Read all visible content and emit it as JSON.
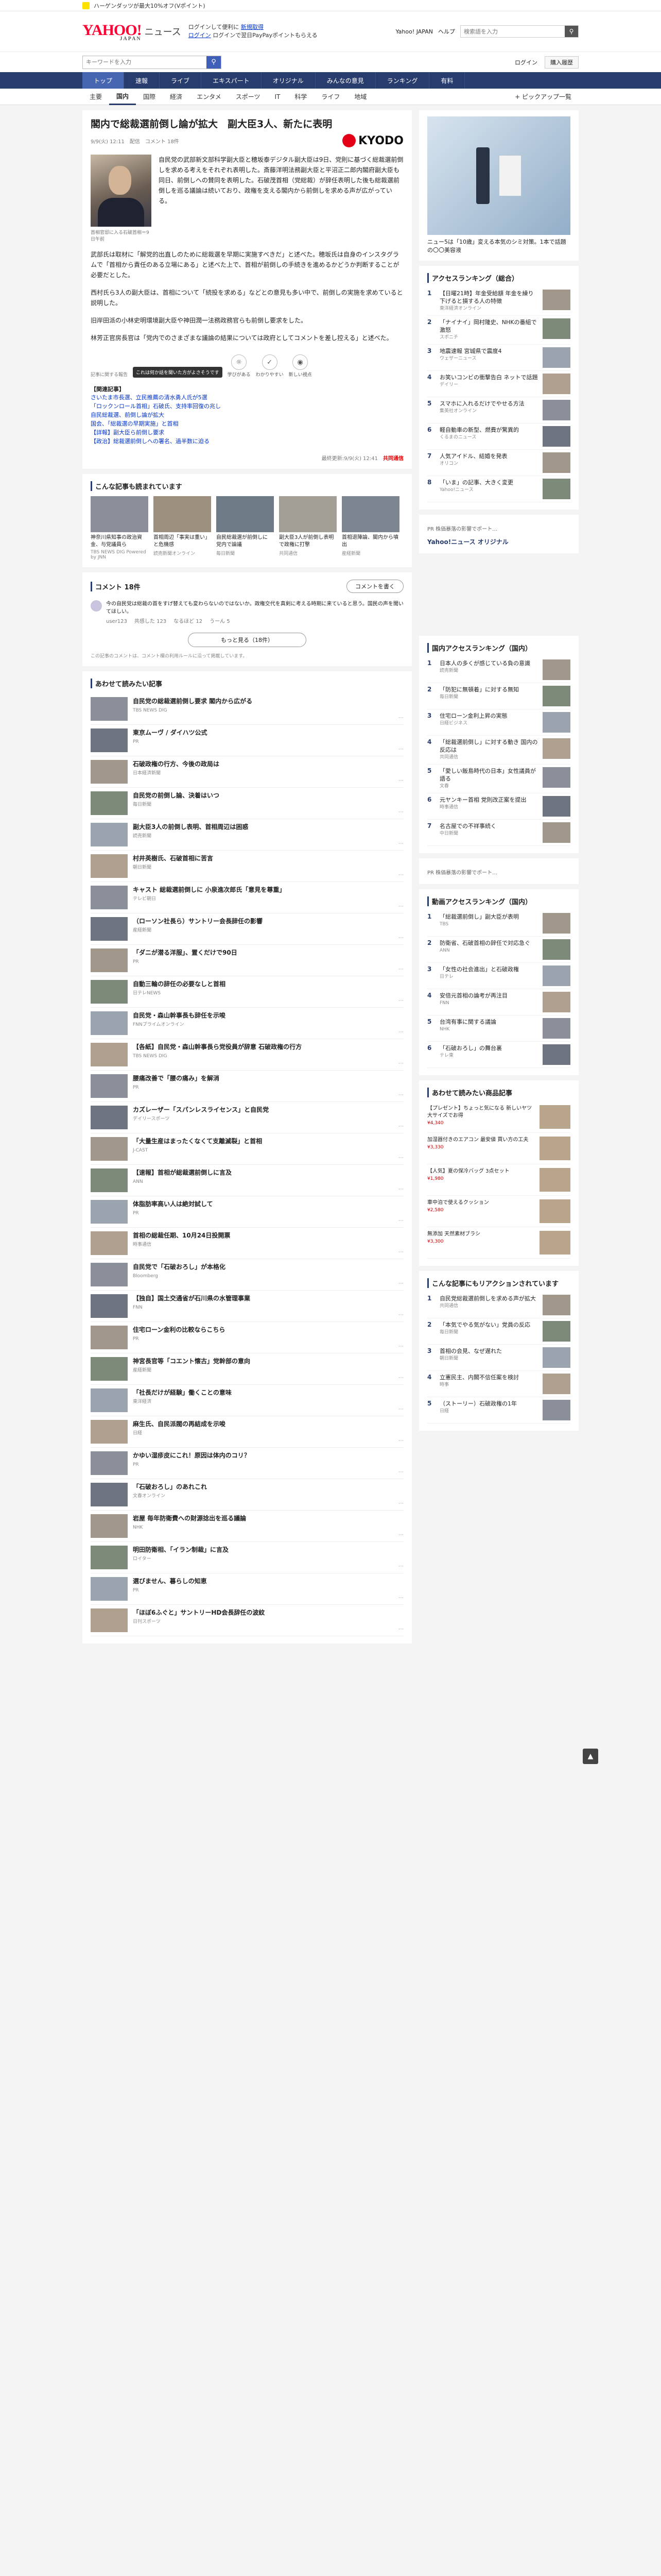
{
  "topstrip": {
    "text": "ハーゲンダッツが最大10%オフ(Vポイント)"
  },
  "header": {
    "logo": "YAHOO!",
    "logo_sub": "JAPAN",
    "service": "ニュース",
    "link1": "ログインして便利に",
    "link1b": "新規取得",
    "link2": "ログイン",
    "link2b": "ログインで翌日PayPayポイントもらえる",
    "right_links": [
      "Yahoo! JAPAN",
      "ヘルプ"
    ],
    "search_placeholder": "検索語を入力"
  },
  "searchbar": {
    "placeholder": "キーワードを入力",
    "links": [
      "ログイン",
      "購入履歴",
      "マイページ"
    ],
    "btn": "購入履歴"
  },
  "nav1": [
    "トップ",
    "速報",
    "ライブ",
    "エキスパート",
    "オリジナル",
    "みんなの意見",
    "ランキング",
    "有料"
  ],
  "nav2": [
    "主要",
    "国内",
    "国際",
    "経済",
    "エンタメ",
    "スポーツ",
    "IT",
    "科学",
    "ライフ",
    "地域"
  ],
  "nav2_active": "国内",
  "nav2_more": "+ ピックアップ一覧",
  "article": {
    "title": "閣内で総裁選前倒し論が拡大　副大臣3人、新たに表明",
    "date": "9/9(火) 12:11",
    "source": "配信",
    "comments": "コメント 18件",
    "publisher": "KYODO",
    "photo_caption": "首相官邸に入る石破首相＝9日午前",
    "paragraphs": [
      "自民党の武部新文部科学副大臣と穂坂泰デジタル副大臣は9日、党則に基づく総裁選前倒しを求める考えをそれぞれ表明した。斎藤洋明法務副大臣と平沼正二郎内閣府副大臣も同日、前倒しへの賛同を表明した。石破茂首相（党総裁）が辞任表明した後も総裁選前倒しを巡る議論は続いており、政権を支える閣内から前倒しを求める声が広がっている。",
      "武部氏は取材に「解党的出直しのために総裁選を早期に実施すべきだ」と述べた。穂坂氏は自身のインスタグラムで「首相から責任のある立場にある」と述べた上で、首相が前倒しの手続きを進めるかどうか判断することが必要だとした。",
      "西村氏ら3人の副大臣は、首相について「続投を求める」などとの意見も多い中で、前倒しの実施を求めていると説明した。",
      "旧岸田派の小林史明環境副大臣や神田潤一法務政務官らも前倒し要求をした。",
      "林芳正官房長官は「党内でのさまざまな議論の結果については政府としてコメントを差し控える」と述べた。"
    ],
    "reaction_tip": "これは何か話を聞いた方がよさそうです",
    "reactions": [
      "学びがある",
      "わかりやすい",
      "新しい視点"
    ],
    "reaction_label": "記事に関する報告",
    "related_title": "【関連記事】",
    "related": [
      "さいたま市長選、立民推薦の清水勇人氏が5選",
      "「ロックンロール首相」石破氏、支持率回復の兆し",
      "自民総裁選、前倒し論が拡大",
      "国会、「総裁選の早期実施」と首相",
      "【詳報】副大臣ら前倒し要求",
      "【政治】総裁選前倒しへの署名、過半数に迫る"
    ],
    "foot_label": "最終更新:9/9(火) 12:41",
    "foot_pub": "共同通信"
  },
  "also_read": {
    "title": "こんな記事も読まれています",
    "items": [
      {
        "text": "神奈川県知事の政治資金、与党議員ら",
        "sub": "TBS NEWS DIG Powered by JNN"
      },
      {
        "text": "首相周辺「事実は重い」と危機感",
        "sub": "読売新聞オンライン"
      },
      {
        "text": "自民総裁選が前倒しに 党内で論議",
        "sub": "毎日新聞"
      },
      {
        "text": "副大臣3人が前倒し表明で政権に打撃",
        "sub": "共同通信"
      },
      {
        "text": "首相退陣論、閣内から噴出",
        "sub": "産経新聞"
      }
    ]
  },
  "comments": {
    "title": "コメント 18件",
    "btn": "コメントを書く",
    "first": "今の自民党は総裁の首をすげ替えても変わらないのではないか。政権交代を真剣に考える時期に来ていると思う。国民の声を聞いてほしい。",
    "first_user": "user123",
    "actions": [
      "共感した 123",
      "なるほど 12",
      "うーん 5"
    ],
    "more": "もっと見る（18件）",
    "note": "この記事のコメントは、コメント欄の利用ルールに沿って掲載しています。"
  },
  "recommend": {
    "title": "あわせて読みたい記事",
    "items": [
      {
        "text": "自民党の総裁選前倒し要求 閣内から広がる",
        "sub": "TBS NEWS DIG"
      },
      {
        "text": "東京ムーヴ / ダイハツ公式",
        "sub": "PR"
      },
      {
        "text": "石破政権の行方、今後の政局は",
        "sub": "日本経済新聞"
      },
      {
        "text": "自民党の前倒し論、決着はいつ",
        "sub": "毎日新聞"
      },
      {
        "text": "副大臣3人の前倒し表明、首相周辺は困惑",
        "sub": "読売新聞"
      },
      {
        "text": "村井英樹氏、石破首相に苦言",
        "sub": "朝日新聞"
      },
      {
        "text": "キャスト 総裁選前倒しに 小泉進次郎氏「意見を尊重」",
        "sub": "テレビ朝日"
      },
      {
        "text": "（ローソン社長ら）サントリー会長辞任の影響",
        "sub": "産経新聞"
      },
      {
        "text": "「ダニが潜る洋服」、置くだけで90日",
        "sub": "PR"
      },
      {
        "text": "自動三輪の辞任の必要なしと首相",
        "sub": "日テレNEWS"
      },
      {
        "text": "自民党・森山幹事長も辞任を示唆",
        "sub": "FNNプライムオンライン"
      },
      {
        "text": "【各紙】自民党・森山幹事長ら党役員が辞意 石破政権の行方",
        "sub": "TBS NEWS DIG"
      },
      {
        "text": "腰痛改善で「腰の痛み」を解消",
        "sub": "PR"
      },
      {
        "text": "カズレーザー「スパンレスライセンス」と自民党",
        "sub": "デイリースポーツ"
      },
      {
        "text": "「大量生産はまったくなくて支離滅裂」と首相",
        "sub": "J-CAST"
      },
      {
        "text": "【速報】首相が総裁選前倒しに言及",
        "sub": "ANN"
      },
      {
        "text": "体脂肪率高い人は絶対試して",
        "sub": "PR"
      },
      {
        "text": "首相の総裁任期、10月24日投開票",
        "sub": "時事通信"
      },
      {
        "text": "自民党で「石破おろし」が本格化",
        "sub": "Bloomberg"
      },
      {
        "text": "【独自】国土交通省が石川県の水管理事業",
        "sub": "FNN"
      },
      {
        "text": "住宅ローン金利の比較ならこちら",
        "sub": "PR"
      },
      {
        "text": "神宮長官等「コエント懐古」党幹部の意向",
        "sub": "産経新聞"
      },
      {
        "text": "「社長だけが経験」働くことの意味",
        "sub": "東洋経済"
      },
      {
        "text": "麻生氏、自民派閥の再結成を示唆",
        "sub": "日経"
      },
      {
        "text": "かゆい湿疹皮にこれ！原因は体内のコリ？",
        "sub": "PR"
      },
      {
        "text": "「石破おろし」のあれこれ",
        "sub": "文春オンライン"
      },
      {
        "text": "岩屋 毎年防衛費への財源捻出を巡る議論",
        "sub": "NHK"
      },
      {
        "text": "明田防衛相、「イラン制裁」に言及",
        "sub": "ロイター"
      },
      {
        "text": "選びません、暮らしの知恵",
        "sub": "PR"
      },
      {
        "text": "「ほぼ6ふぐと」サントリーHD会長辞任の波紋",
        "sub": "日刊スポーツ"
      }
    ]
  },
  "sidebar": {
    "ad_caption": "ニュー5は「10歳」変える本気のシミ対策。1本で話題の〇〇美容液",
    "access_title": "アクセスランキング（総合）",
    "access": [
      {
        "text": "【日曜21時】年金受給額 年金を繰り下げると損する人の特徴",
        "sub": "東洋経済オンライン"
      },
      {
        "text": "「ナイナイ」岡村隆史、NHKの番組で激怒",
        "sub": "スポニチ"
      },
      {
        "text": "地震速報 宮城県で震度4",
        "sub": "ウェザーニュース"
      },
      {
        "text": "お笑いコンビの衝撃告白 ネットで話題",
        "sub": "デイリー"
      },
      {
        "text": "スマホに入れるだけでやせる方法",
        "sub": "集英社オンライン"
      },
      {
        "text": "軽自動車の新型、燃費が驚異的",
        "sub": "くるまのニュース"
      },
      {
        "text": "人気アイドル、結婚を発表",
        "sub": "オリコン"
      },
      {
        "text": "「いま」の記事、大きく変更",
        "sub": "Yahoo!ニュース"
      }
    ],
    "pr1": "PR 株価暴落の影響でポート…",
    "expert_title": "Yahoo!ニュース オリジナル",
    "domestic_title": "国内アクセスランキング（国内）",
    "domestic": [
      {
        "text": "日本人の多くが感じている負の意識",
        "sub": "読売新聞"
      },
      {
        "text": "「防犯に無頓着」に対する無知",
        "sub": "毎日新聞"
      },
      {
        "text": "住宅ローン金利上昇の実態",
        "sub": "日経ビジネス"
      },
      {
        "text": "「総裁選前倒し」に対する動き 国内の反応は",
        "sub": "共同通信"
      },
      {
        "text": "「愛しい飯島時代の日本」女性議員が語る",
        "sub": "文春"
      },
      {
        "text": "元ヤンキー首相 党則改正案を提出",
        "sub": "時事通信"
      },
      {
        "text": "名古屋での不祥事続く",
        "sub": "中日新聞"
      }
    ],
    "pr2": "PR 株価暴落の影響でポート…",
    "video_title": "動画アクセスランキング（国内）",
    "video": [
      {
        "text": "「総裁選前倒し」副大臣が表明",
        "sub": "TBS"
      },
      {
        "text": "防衛省、石破首相の辞任で対応急ぐ",
        "sub": "ANN"
      },
      {
        "text": "「女性の社会進出」と石破政権",
        "sub": "日テレ"
      },
      {
        "text": "安倍元首相の論考が再注目",
        "sub": "FNN"
      },
      {
        "text": "台湾有事に関する議論",
        "sub": "NHK"
      },
      {
        "text": "「石破おろし」の舞台裏",
        "sub": "テレ東"
      }
    ],
    "ad_title": "あわせて読みたい商品記事",
    "ad_rows": [
      {
        "text": "【プレゼント】ちょっと気になる 新しいヤツ 大サイズでお得",
        "price": "¥4,340"
      },
      {
        "text": "加湿器付きのエアコン 最安値 買い方の工夫",
        "price": "¥3,330"
      },
      {
        "text": "【人気】夏の保冷バッグ 3点セット",
        "price": "¥1,980"
      },
      {
        "text": "車中泊で使えるクッション",
        "price": "¥2,580"
      },
      {
        "text": "無添加 天然素材ブラシ",
        "price": "¥3,300"
      }
    ],
    "reaction_title": "こんな記事にもリアクションされています",
    "reaction_rows": [
      {
        "text": "自民党総裁選前倒しを求める声が拡大",
        "sub": "共同通信"
      },
      {
        "text": "「本気でやる気がない」党員の反応",
        "sub": "毎日新聞"
      },
      {
        "text": "首相の会見、なぜ遅れた",
        "sub": "朝日新聞"
      },
      {
        "text": "立憲民主、内閣不信任案を検討",
        "sub": "時事"
      },
      {
        "text": "（ストーリー）石破政権の1年",
        "sub": "日経"
      }
    ]
  }
}
